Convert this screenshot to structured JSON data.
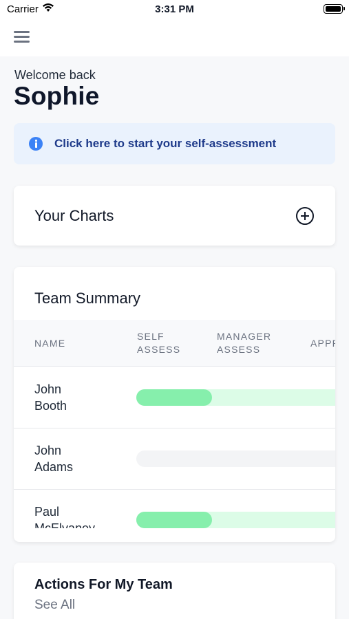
{
  "status_bar": {
    "carrier": "Carrier",
    "time": "3:31 PM"
  },
  "app_bar": {
    "menu_icon": "hamburger-menu-icon"
  },
  "greeting": {
    "welcome": "Welcome back",
    "name": "Sophie"
  },
  "banner": {
    "icon": "info-icon",
    "text": "Click here to start your self-assessment",
    "background": "#eaf2fd",
    "text_color": "#1e3a8a"
  },
  "charts_card": {
    "title": "Your Charts",
    "add_icon": "plus-circle-icon"
  },
  "team_summary": {
    "title": "Team Summary",
    "columns": [
      {
        "line1": "NAME",
        "line2": ""
      },
      {
        "line1": "SELF",
        "line2": "ASSESS"
      },
      {
        "line1": "MANAGER",
        "line2": "ASSESS"
      },
      {
        "line1": "APPR",
        "line2": ""
      }
    ],
    "rows": [
      {
        "first": "John",
        "last": "Booth",
        "self_assess_progress": 0.38,
        "track_color": "#dcfce7"
      },
      {
        "first": "John",
        "last": "Adams",
        "self_assess_progress": 0,
        "track_color": "#f3f4f6"
      },
      {
        "first": "Paul",
        "last": "McElvaney",
        "self_assess_progress": 0.38,
        "track_color": "#dcfce7"
      }
    ],
    "progress_color": "#86efac"
  },
  "actions_card": {
    "title": "Actions For My Team",
    "link": "See All"
  }
}
